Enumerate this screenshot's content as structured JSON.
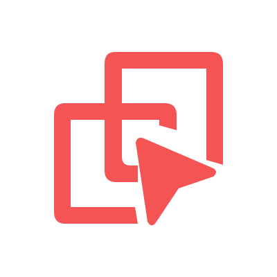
{
  "icon": {
    "name": "overlapping-squares-cursor-icon",
    "color": "#F45454",
    "background": "#FFFFFF"
  }
}
